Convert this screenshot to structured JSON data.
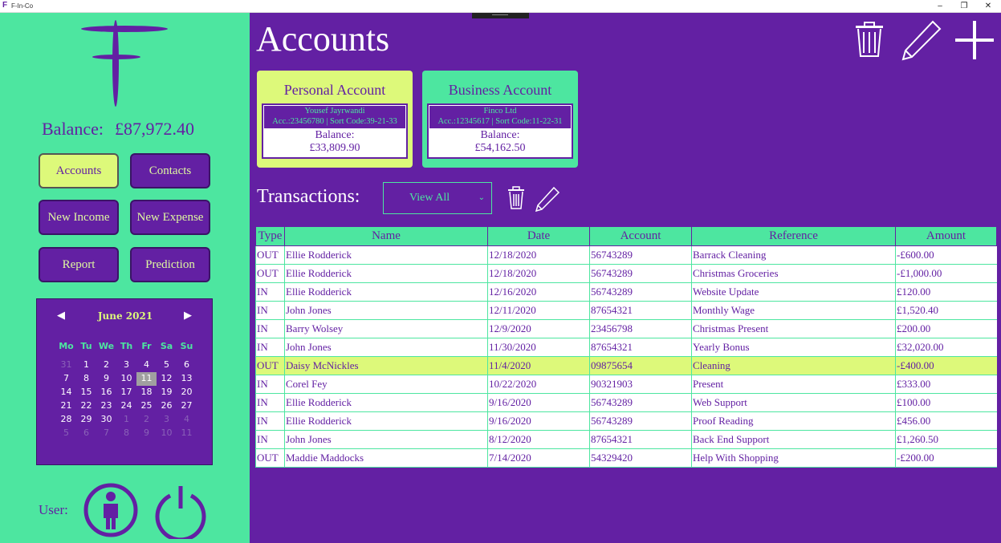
{
  "window": {
    "title": "F-In-Co",
    "minimize": "–",
    "restore": "❐",
    "close": "✕"
  },
  "sidebar": {
    "balance_label": "Balance:",
    "balance_value": "£87,972.40",
    "nav": {
      "accounts": "Accounts",
      "contacts": "Contacts",
      "new_income": "New Income",
      "new_expense": "New Expense",
      "report": "Report",
      "prediction": "Prediction"
    },
    "calendar": {
      "month": "June 2021",
      "dows": [
        "Mo",
        "Tu",
        "We",
        "Th",
        "Fr",
        "Sa",
        "Su"
      ],
      "days": [
        "31",
        "1",
        "2",
        "3",
        "4",
        "5",
        "6",
        "7",
        "8",
        "9",
        "10",
        "11",
        "12",
        "13",
        "14",
        "15",
        "16",
        "17",
        "18",
        "19",
        "20",
        "21",
        "22",
        "23",
        "24",
        "25",
        "26",
        "27",
        "28",
        "29",
        "30",
        "1",
        "2",
        "3",
        "4",
        "5",
        "6",
        "7",
        "8",
        "9",
        "10",
        "11"
      ],
      "today": "11"
    },
    "user_label": "User:"
  },
  "main": {
    "title": "Accounts",
    "accounts": [
      {
        "name": "Personal Account",
        "holder": "Yousef Jayrwandi",
        "details": "Acc.:23456780 | Sort Code:39-21-33",
        "balance_label": "Balance:",
        "balance": "£33,809.90"
      },
      {
        "name": "Business Account",
        "holder": "Finco Ltd",
        "details": "Acc.:12345617 | Sort Code:11-22-31",
        "balance_label": "Balance:",
        "balance": "£54,162.50"
      }
    ],
    "transactions_label": "Transactions:",
    "filter": "View All",
    "columns": [
      "Type",
      "Name",
      "Date",
      "Account",
      "Reference",
      "Amount"
    ],
    "rows": [
      [
        "OUT",
        "Ellie Rodderick",
        "12/18/2020",
        "56743289",
        "Barrack Cleaning",
        "-£600.00"
      ],
      [
        "OUT",
        "Ellie Rodderick",
        "12/18/2020",
        "56743289",
        "Christmas Groceries",
        "-£1,000.00"
      ],
      [
        "IN",
        "Ellie Rodderick",
        "12/16/2020",
        "56743289",
        "Website Update",
        "£120.00"
      ],
      [
        "IN",
        "John Jones",
        "12/11/2020",
        "87654321",
        "Monthly Wage",
        "£1,520.40"
      ],
      [
        "IN",
        "Barry Wolsey",
        "12/9/2020",
        "23456798",
        "Christmas Present",
        "£200.00"
      ],
      [
        "IN",
        "John Jones",
        "11/30/2020",
        "87654321",
        "Yearly Bonus",
        "£32,020.00"
      ],
      [
        "OUT",
        "Daisy McNickles",
        "11/4/2020",
        "09875654",
        "Cleaning",
        "-£400.00"
      ],
      [
        "IN",
        "Corel Fey",
        "10/22/2020",
        "90321903",
        "Present",
        "£333.00"
      ],
      [
        "IN",
        "Ellie Rodderick",
        "9/16/2020",
        "56743289",
        "Web Support",
        "£100.00"
      ],
      [
        "IN",
        "Ellie Rodderick",
        "9/16/2020",
        "56743289",
        "Proof  Reading",
        "£456.00"
      ],
      [
        "IN",
        "John Jones",
        "8/12/2020",
        "87654321",
        "Back End Support",
        "£1,260.50"
      ],
      [
        "OUT",
        "Maddie Maddocks",
        "7/14/2020",
        "54329420",
        "Help With Shopping",
        "-£200.00"
      ]
    ],
    "highlighted_row": 6
  },
  "colors": {
    "purple": "#6320a3",
    "green": "#4de6a0",
    "lime": "#ddf97a"
  }
}
